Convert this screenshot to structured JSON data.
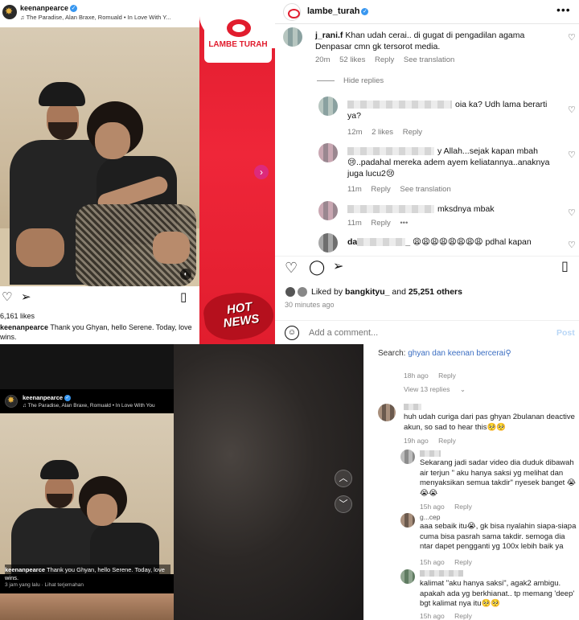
{
  "top_left": {
    "username": "keenanpearce",
    "music": "The Paradise, Alan Braxe, Romuald • In Love With Y...",
    "brand_logo_text": "LAMBE TURAH",
    "hot_news_line1": "HOT",
    "hot_news_line2": "NEWS",
    "likes": "6,161 likes",
    "caption_user": "keenanpearce",
    "caption_text": "Thank you Ghyan, hello Serene. Today, love",
    "caption_text_2": "wins."
  },
  "top_right": {
    "username": "lambe_turah",
    "comments": [
      {
        "user": "j_rani.f",
        "text": "Khan udah cerai.. di gugat di pengadilan agama Denpasar cmn gk tersorot media.",
        "time": "20m",
        "likes": "52 likes",
        "reply": "Reply",
        "translate": "See translation"
      }
    ],
    "hide_replies": "Hide replies",
    "replies": [
      {
        "text": "oia ka? Udh lama berarti ya?",
        "time": "12m",
        "likes": "2 likes",
        "reply": "Reply"
      },
      {
        "text": "y Allah...sejak kapan mbah 😢..padahal mereka adem ayem keliatannya..anaknya juga lucu2😢",
        "time": "11m",
        "reply": "Reply",
        "translate": "See translation"
      },
      {
        "text": "mksdnya mbak",
        "time": "11m",
        "reply": "Reply",
        "more": "•••"
      },
      {
        "user_prefix": "da",
        "user_suffix": "_",
        "text": "😩😩😩😩😩😩😩😩 pdhal kapan"
      }
    ],
    "liked_by_prefix": "Liked by",
    "liked_by_user": "bangkityu_",
    "liked_by_and": "and",
    "liked_by_count": "25,251 others",
    "time_ago": "30 minutes ago",
    "add_comment_placeholder": "Add a comment...",
    "post_label": "Post"
  },
  "bottom_left": {
    "username": "keenanpearce",
    "music": "The Paradise, Alan Braxe, Romuald • In Love With You",
    "caption_user": "keenanpearce",
    "caption_text": "Thank you Ghyan, hello Serene. Today, love wins.",
    "meta_time": "3 jam yang lalu",
    "meta_translate": "Lihat terjemahan"
  },
  "bottom_right": {
    "search_label": "Search:",
    "search_query": "ghyan dan keenan bercerai",
    "top_meta": {
      "time": "18h ago",
      "reply": "Reply"
    },
    "view_replies": "View 13 replies",
    "comments": [
      {
        "text": "huh udah curiga dari pas ghyan 2bulanan deactive akun, so sad to hear this🥺🥺",
        "time": "19h ago",
        "reply": "Reply"
      },
      {
        "text": "Sekarang jadi sadar video dia duduk dibawah air terjun \" aku hanya saksi yg melihat dan menyaksikan semua takdir\" nyesek banget 😭😭😭",
        "time": "15h ago",
        "reply": "Reply"
      },
      {
        "name_text": "g...cep",
        "text": "aaa sebaik itu😭, gk bisa nyalahin siapa-siapa cuma bisa pasrah sama takdir. semoga dia ntar dapet pengganti yg 100x lebih baik ya",
        "time": "15h ago",
        "reply": "Reply"
      },
      {
        "text": "kalimat \"aku hanya saksi\", agak2 ambigu. apakah ada yg berkhianat.. tp memang 'deep' bgt kalimat nya itu🥺🥺",
        "time": "15h ago",
        "reply": "Reply"
      }
    ]
  },
  "colors": {
    "brand_red": "#e11d2e",
    "link_blue": "#3b6ec2",
    "verified_blue": "#3897f0"
  }
}
